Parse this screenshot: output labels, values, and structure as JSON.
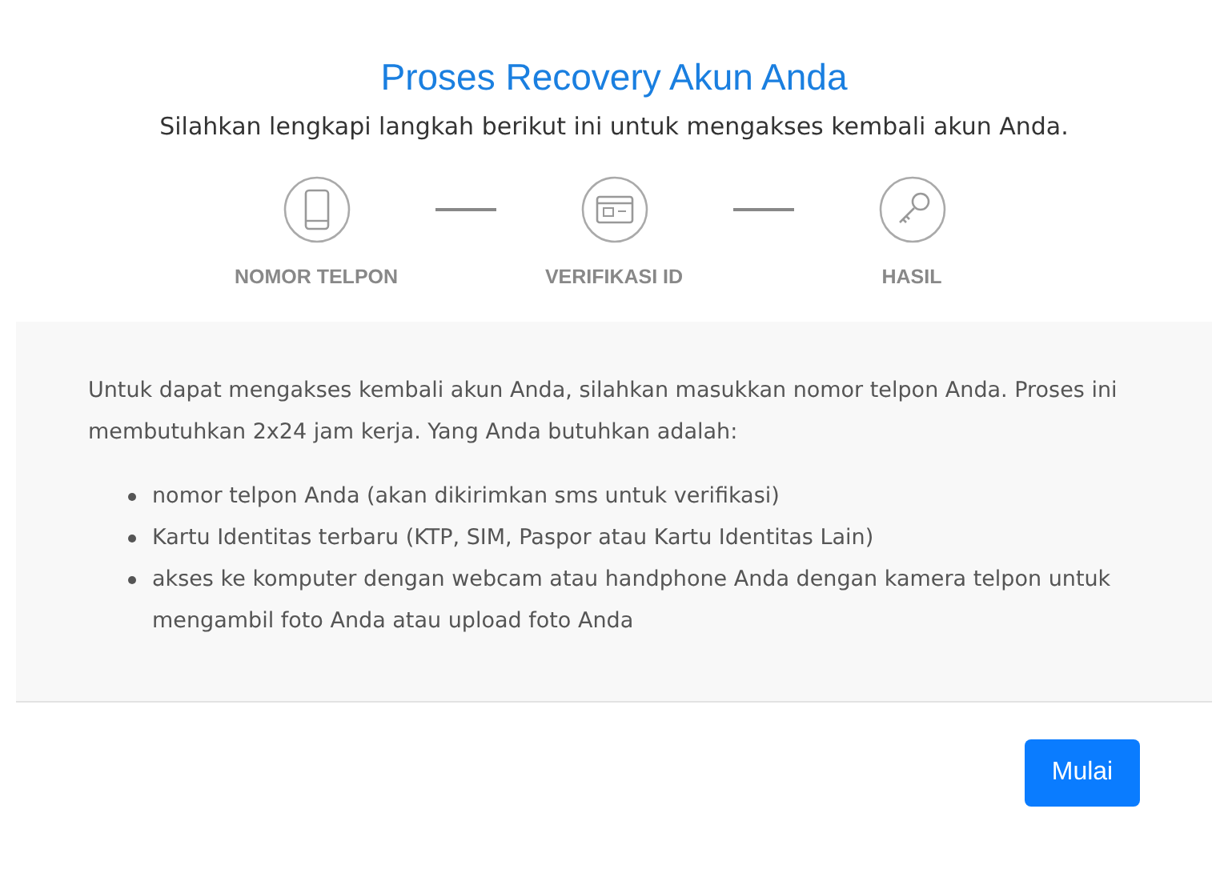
{
  "title": "Proses Recovery Akun Anda",
  "subtitle": "Silahkan lengkapi langkah berikut ini untuk mengakses kembali akun Anda.",
  "steps": [
    {
      "label": "NOMOR TELPON"
    },
    {
      "label": "VERIFIKASI ID"
    },
    {
      "label": "HASIL"
    }
  ],
  "intro": "Untuk dapat mengakses kembali akun Anda, silahkan masukkan nomor telpon Anda. Proses ini membutuhkan 2x24 jam kerja. Yang Anda butuhkan adalah:",
  "requirements": [
    "nomor telpon Anda (akan dikirimkan sms untuk verifikasi)",
    "Kartu Identitas terbaru (KTP, SIM, Paspor atau Kartu Identitas Lain)",
    "akses ke komputer dengan webcam atau handphone Anda dengan kamera telpon untuk mengambil foto Anda atau upload foto Anda"
  ],
  "button": "Mulai"
}
